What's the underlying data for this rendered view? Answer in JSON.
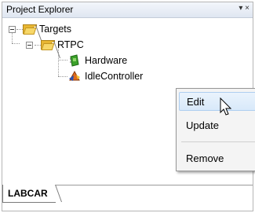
{
  "panel": {
    "title": "Project Explorer",
    "title_controls": "▾ ×"
  },
  "tree": {
    "items": [
      {
        "label": "Targets",
        "icon": "folder-icon"
      },
      {
        "label": "RTPC",
        "icon": "folder-icon"
      },
      {
        "label": "Hardware",
        "icon": "green-board-icon"
      },
      {
        "label": "IdleController",
        "icon": "controller-icon"
      }
    ]
  },
  "context_menu": {
    "items": [
      "Edit",
      "Update",
      "Remove"
    ]
  },
  "bottom_tabs": [
    "LABCAR"
  ],
  "colors": {
    "folder": "#e8b632",
    "hover": "#d8e9fa",
    "menu_bg": "#f4f4f4"
  }
}
